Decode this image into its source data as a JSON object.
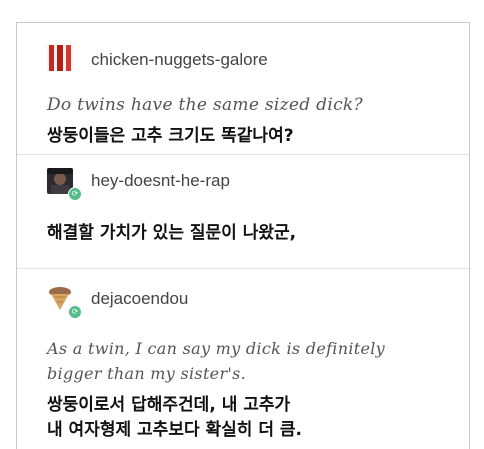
{
  "posts": [
    {
      "username": "chicken-nuggets-galore",
      "avatar_icon": "red-bars-avatar-icon",
      "text": "Do twins have the same sized dick?",
      "translation": "쌍둥이들은 고추 크기도 똑같나여?"
    },
    {
      "username": "hey-doesnt-he-rap",
      "avatar_icon": "photo-avatar-icon",
      "translation": "해결할 가치가 있는 질문이 나왔군,"
    },
    {
      "username": "dejacoendou",
      "avatar_icon": "ice-cream-cone-avatar-icon",
      "text_line1": "As a twin, I can say my dick is definitely",
      "text_line2": "bigger than my sister's.",
      "translation_line1": "쌍둥이로서 답해주건데, 내 고추가",
      "translation_line2": "내 여자형제 고추보다 확실히 더 큼."
    }
  ],
  "colors": {
    "reblog_badge": "#56bc8a",
    "username": "#444444",
    "handwritten_text": "#555555"
  }
}
